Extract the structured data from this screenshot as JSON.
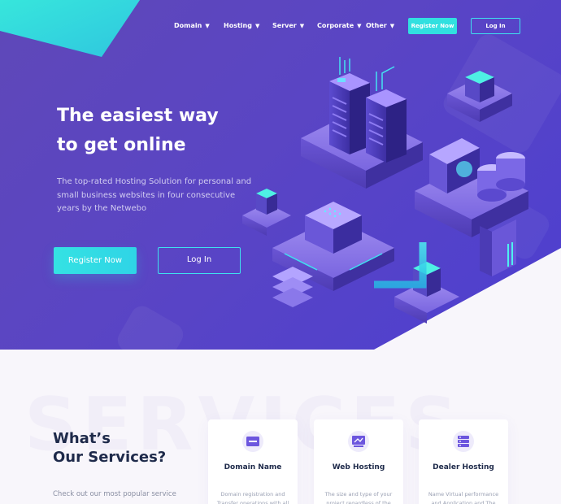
{
  "nav": {
    "items": [
      {
        "label": "Domain"
      },
      {
        "label": "Hosting"
      },
      {
        "label": "Server"
      },
      {
        "label": "Corporate"
      },
      {
        "label": "Other"
      }
    ],
    "register_label": "Register Now",
    "login_label": "Log In"
  },
  "hero": {
    "headline_line1": "The easiest way",
    "headline_line2": "to get online",
    "subtext": "The top-rated Hosting Solution for personal and small business websites in four consecutive years by the Netwebo",
    "register_label": "Register Now",
    "login_label": "Log In"
  },
  "services": {
    "watermark": "SERVICES",
    "title_line1": "What’s",
    "title_line2": "Our Services?",
    "subtitle": "Check out our most popular service",
    "cards": [
      {
        "title": "Domain Name",
        "desc": "Domain registration and Transfer operations with all",
        "icon": "www-icon"
      },
      {
        "title": "Web Hosting",
        "desc": "The size and type of your project regardless of the best",
        "icon": "monitor-icon"
      },
      {
        "title": "Dealer Hosting",
        "desc": "Name Virtual performance and Application and The",
        "icon": "server-icon"
      }
    ]
  },
  "colors": {
    "hero_bg": "#5a45c4",
    "accent_teal": "#31e0e0",
    "title_dark": "#1e2a4a"
  }
}
